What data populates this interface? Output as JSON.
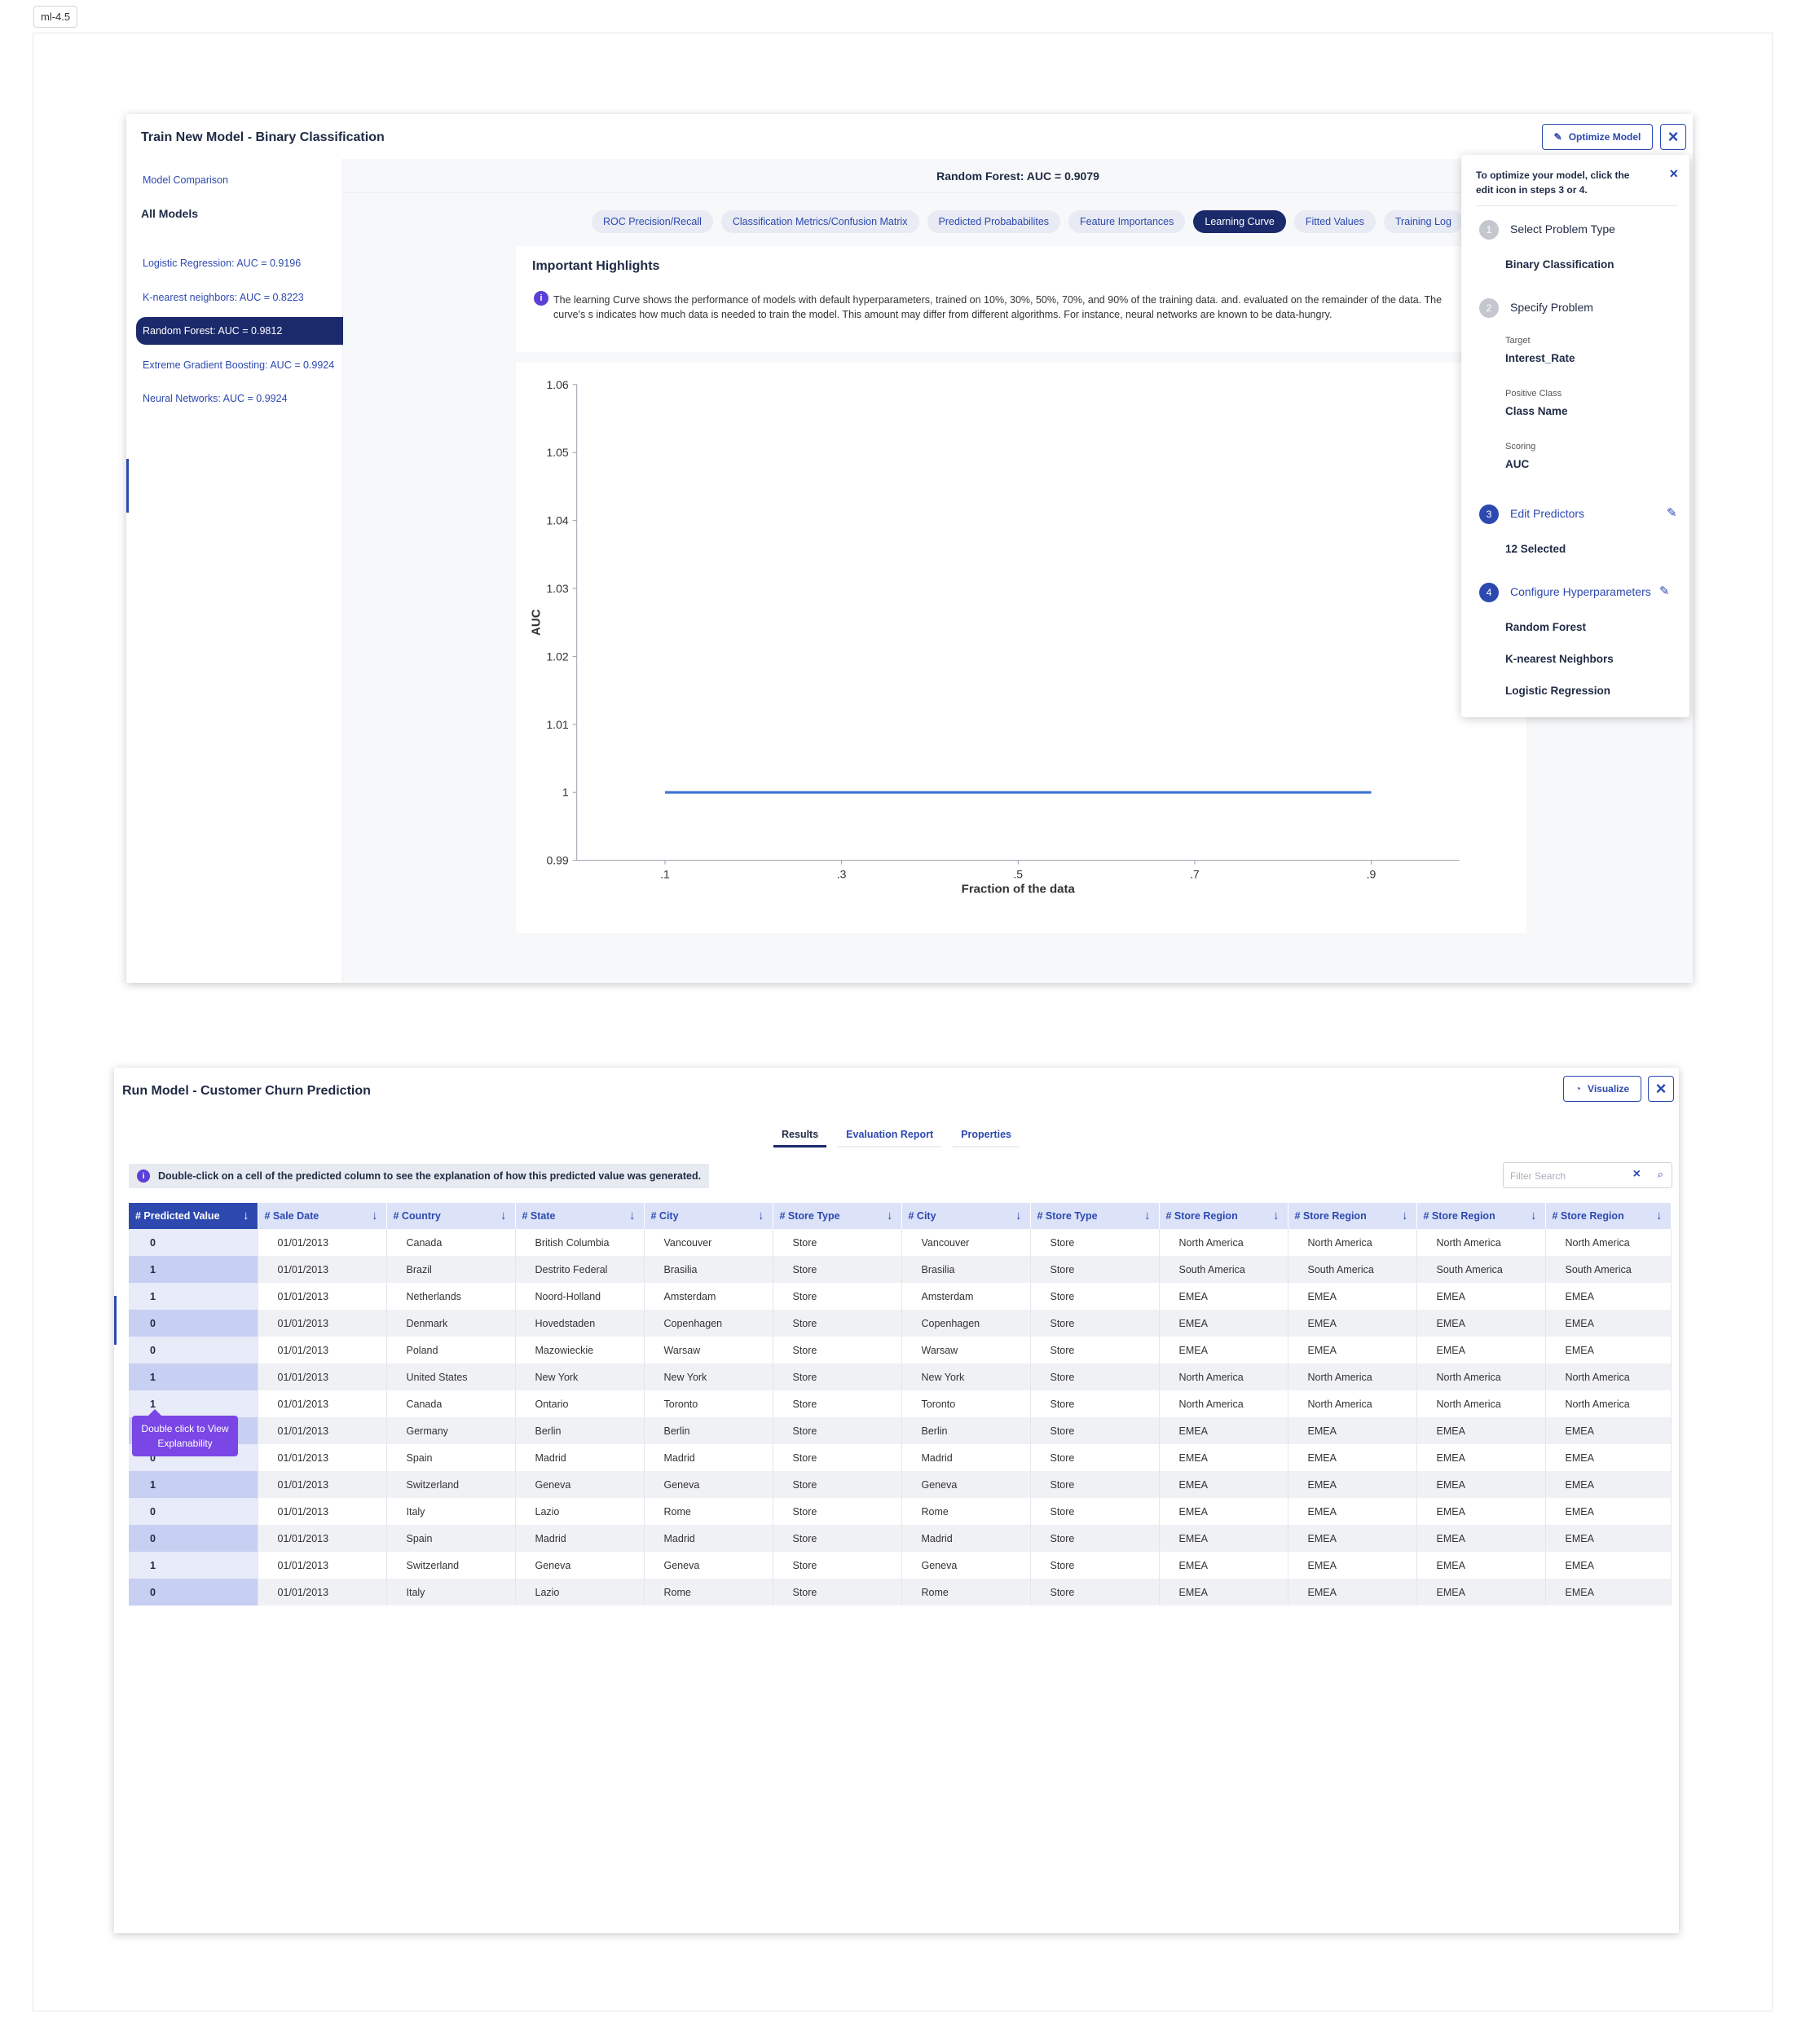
{
  "page_tag": "ml-4.5",
  "train": {
    "title": "Train New Model - Binary Classification",
    "optimize_label": "Optimize Model",
    "model_comparison": "Model Comparison",
    "all_models": "All Models",
    "models": [
      {
        "label": "Logistic Regression: AUC = 0.9196"
      },
      {
        "label": "K-nearest neighbors: AUC = 0.8223"
      },
      {
        "label": "Random Forest: AUC = 0.9812"
      },
      {
        "label": "Extreme Gradient Boosting: AUC = 0.9924"
      },
      {
        "label": "Neural Networks: AUC = 0.9924"
      }
    ],
    "active_model_index": 2,
    "header": "Random Forest: AUC = 0.9079",
    "tabs": [
      {
        "label": "ROC Precision/Recall"
      },
      {
        "label": "Classification Metrics/Confusion Matrix"
      },
      {
        "label": "Predicted Probababilites"
      },
      {
        "label": "Feature Importances"
      },
      {
        "label": "Learning Curve"
      },
      {
        "label": "Fitted Values"
      },
      {
        "label": "Training Log"
      }
    ],
    "active_tab_index": 4,
    "highlights_title": "Important Highlights",
    "highlights_text": "The learning Curve shows the performance of models with default hyperparameters, trained on 10%, 30%, 50%, 70%, and 90% of the training data. and. evaluated on the remainder of the data. The curve's s indicates how much data is needed to train the model. This amount may differ from different algorithms. For instance, neural networks are known to be data-hungry."
  },
  "chart_data": {
    "type": "line",
    "xlabel": "Fraction of the data",
    "ylabel": "AUC",
    "x": [
      0.1,
      0.3,
      0.5,
      0.7,
      0.9
    ],
    "x_tick_labels": [
      ".1",
      ".3",
      ".5",
      ".7",
      ".9"
    ],
    "y_ticks": [
      0.99,
      1,
      1.01,
      1.02,
      1.03,
      1.04,
      1.05,
      1.06
    ],
    "y_tick_labels": [
      "0.99",
      "1",
      "1.01",
      "1.02",
      "1.03",
      "1.04",
      "1.05",
      "1.06"
    ],
    "ylim": [
      0.99,
      1.06
    ],
    "series": [
      {
        "values": [
          1,
          1,
          1,
          1,
          1
        ],
        "color": "#3b73d1"
      }
    ],
    "grid": false
  },
  "optimize_panel": {
    "hint": "To optimize your model, click the edit icon in steps 3 or 4.",
    "steps": [
      {
        "num": "1",
        "label": "Select Problem Type"
      },
      {
        "num": "2",
        "label": "Specify Problem"
      },
      {
        "num": "3",
        "label": "Edit Predictors"
      },
      {
        "num": "4",
        "label": "Configure Hyperparameters"
      }
    ],
    "problem_type": "Binary Classification",
    "target_label": "Target",
    "target_value": "Interest_Rate",
    "positive_class_label": "Positive Class",
    "positive_class_value": "Class Name",
    "scoring_label": "Scoring",
    "scoring_value": "AUC",
    "predictors_value": "12 Selected",
    "hyperparameters": [
      "Random Forest",
      "K-nearest Neighbors",
      "Logistic Regression"
    ]
  },
  "run": {
    "title": "Run Model - Customer Churn Prediction",
    "visualize_label": "Visualize",
    "tabs": [
      {
        "label": "Results"
      },
      {
        "label": "Evaluation Report"
      },
      {
        "label": "Properties"
      }
    ],
    "active_tab_index": 0,
    "info_text": "Double-click on a cell of the predicted column to see the explanation of how this predicted value was generated.",
    "filter_placeholder": "Filter Search",
    "tooltip": "Double click to View Explanability",
    "columns": [
      "# Predicted Value",
      "# Sale Date",
      "# Country",
      "# State",
      "# City",
      "# Store Type",
      "# City",
      "# Store Type",
      "# Store Region",
      "# Store Region",
      "# Store Region",
      "# Store Region"
    ],
    "rows": [
      [
        "0",
        "01/01/2013",
        "Canada",
        "British Columbia",
        "Vancouver",
        "Store",
        "Vancouver",
        "Store",
        "North America",
        "North America",
        "North America",
        "North America"
      ],
      [
        "1",
        "01/01/2013",
        "Brazil",
        "Destrito Federal",
        "Brasilia",
        "Store",
        "Brasilia",
        "Store",
        "South America",
        "South America",
        "South America",
        "South America"
      ],
      [
        "1",
        "01/01/2013",
        "Netherlands",
        "Noord-Holland",
        "Amsterdam",
        "Store",
        "Amsterdam",
        "Store",
        "EMEA",
        "EMEA",
        "EMEA",
        "EMEA"
      ],
      [
        "0",
        "01/01/2013",
        "Denmark",
        "Hovedstaden",
        "Copenhagen",
        "Store",
        "Copenhagen",
        "Store",
        "EMEA",
        "EMEA",
        "EMEA",
        "EMEA"
      ],
      [
        "0",
        "01/01/2013",
        "Poland",
        "Mazowieckie",
        "Warsaw",
        "Store",
        "Warsaw",
        "Store",
        "EMEA",
        "EMEA",
        "EMEA",
        "EMEA"
      ],
      [
        "1",
        "01/01/2013",
        "United States",
        "New York",
        "New York",
        "Store",
        "New York",
        "Store",
        "North America",
        "North America",
        "North America",
        "North America"
      ],
      [
        "1",
        "01/01/2013",
        "Canada",
        "Ontario",
        "Toronto",
        "Store",
        "Toronto",
        "Store",
        "North America",
        "North America",
        "North America",
        "North America"
      ],
      [
        "",
        "01/01/2013",
        "Germany",
        "Berlin",
        "Berlin",
        "Store",
        "Berlin",
        "Store",
        "EMEA",
        "EMEA",
        "EMEA",
        "EMEA"
      ],
      [
        "0",
        "01/01/2013",
        "Spain",
        "Madrid",
        "Madrid",
        "Store",
        "Madrid",
        "Store",
        "EMEA",
        "EMEA",
        "EMEA",
        "EMEA"
      ],
      [
        "1",
        "01/01/2013",
        "Switzerland",
        "Geneva",
        "Geneva",
        "Store",
        "Geneva",
        "Store",
        "EMEA",
        "EMEA",
        "EMEA",
        "EMEA"
      ],
      [
        "0",
        "01/01/2013",
        "Italy",
        "Lazio",
        "Rome",
        "Store",
        "Rome",
        "Store",
        "EMEA",
        "EMEA",
        "EMEA",
        "EMEA"
      ],
      [
        "0",
        "01/01/2013",
        "Spain",
        "Madrid",
        "Madrid",
        "Store",
        "Madrid",
        "Store",
        "EMEA",
        "EMEA",
        "EMEA",
        "EMEA"
      ],
      [
        "1",
        "01/01/2013",
        "Switzerland",
        "Geneva",
        "Geneva",
        "Store",
        "Geneva",
        "Store",
        "EMEA",
        "EMEA",
        "EMEA",
        "EMEA"
      ],
      [
        "0",
        "01/01/2013",
        "Italy",
        "Lazio",
        "Rome",
        "Store",
        "Rome",
        "Store",
        "EMEA",
        "EMEA",
        "EMEA",
        "EMEA"
      ]
    ]
  }
}
